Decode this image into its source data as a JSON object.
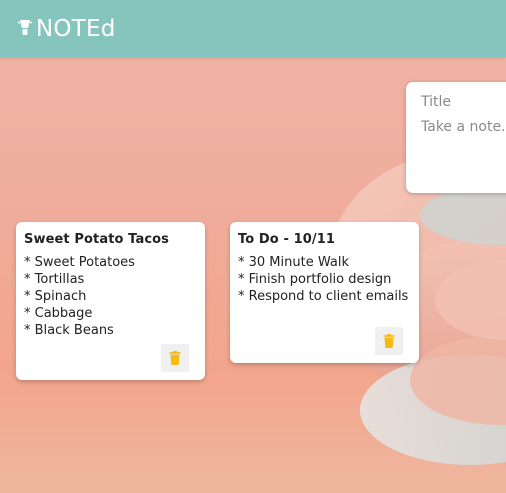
{
  "app": {
    "brand": "NOTEd",
    "brand_icon": "lightbulb-icon"
  },
  "composer": {
    "title_placeholder": "Title",
    "content_placeholder": "Take a note..."
  },
  "notes": [
    {
      "title": "Sweet Potato Tacos",
      "content": "* Sweet Potatoes\n* Tortillas\n* Spinach\n* Cabbage\n* Black Beans",
      "delete_icon": "trash-icon"
    },
    {
      "title": "To Do - 10/11",
      "content": "* 30 Minute Walk\n* Finish portfolio design\n* Respond to client emails",
      "delete_icon": "trash-icon"
    }
  ],
  "colors": {
    "header": "#86c5bd",
    "accent": "#f5ba13",
    "background": "#f0ad9d"
  }
}
